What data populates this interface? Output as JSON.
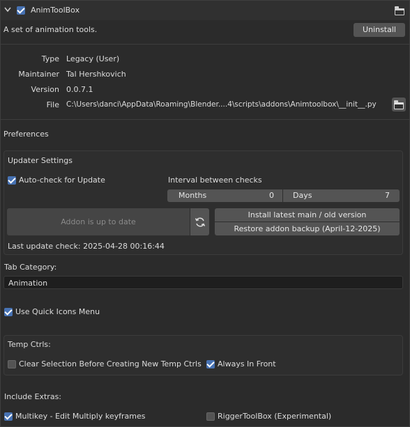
{
  "header": {
    "title": "AnimToolBox"
  },
  "description": "A set of animation tools.",
  "uninstall_label": "Uninstall",
  "info": {
    "type_label": "Type",
    "type_value": "Legacy (User)",
    "maintainer_label": "Maintainer",
    "maintainer_value": "Tal Hershkovich",
    "version_label": "Version",
    "version_value": "0.0.7.1",
    "file_label": "File",
    "file_value": "C:\\Users\\danci\\AppData\\Roaming\\Blender....4\\scripts\\addons\\Animtoolbox\\__init__.py"
  },
  "preferences_label": "Preferences",
  "updater": {
    "title": "Updater Settings",
    "auto_check_label": "Auto-check for Update",
    "auto_check": true,
    "interval_label": "Interval between checks",
    "months_label": "Months",
    "months_value": "0",
    "days_label": "Days",
    "days_value": "7",
    "status_button": "Addon is up to date",
    "install_label": "Install latest main / old version",
    "restore_label": "Restore addon backup (April-12-2025)",
    "last_check": "Last update check: 2025-04-28 00:16:44"
  },
  "tab_category_label": "Tab Category:",
  "tab_category_value": "Animation",
  "quick_icons_label": "Use Quick Icons Menu",
  "temp_ctrls": {
    "title": "Temp Ctrls:",
    "clear_selection_label": "Clear Selection Before Creating New Temp Ctrls",
    "always_in_front_label": "Always In Front"
  },
  "extras": {
    "title": "Include Extras:",
    "multikey_label": "Multikey - Edit Multiply keyframes",
    "rigger_label": "RiggerToolBox (Experimental)"
  },
  "colors": {
    "accent": "#4772b3",
    "button": "#545454",
    "background": "#2b2b2b"
  }
}
